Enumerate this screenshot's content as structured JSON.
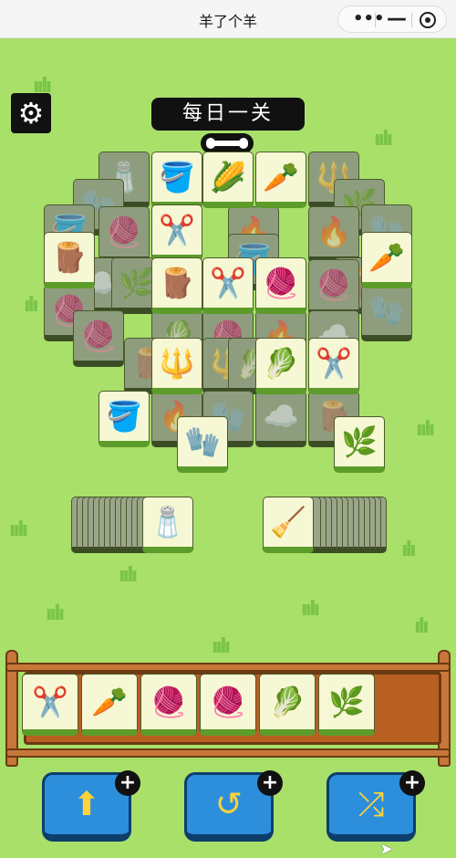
{
  "window": {
    "title": "羊了个羊"
  },
  "capsule": {
    "dots": "•••",
    "minus": "—"
  },
  "level": {
    "label": "每日一关"
  },
  "board": {
    "tiles_top": [
      {
        "icon": "🧂",
        "dim": true
      },
      {
        "icon": "🪣",
        "dim": false
      },
      {
        "icon": "🌽",
        "dim": false
      },
      {
        "icon": "🥕",
        "dim": false
      },
      {
        "icon": "🔱",
        "dim": true
      }
    ],
    "tiles_main": [
      {
        "icon": "✂️",
        "dim": false
      },
      {
        "icon": "🪵",
        "dim": false
      },
      {
        "icon": "✂️",
        "dim": false
      },
      {
        "icon": "🧶",
        "dim": false
      },
      {
        "icon": "🪵",
        "dim": false
      },
      {
        "icon": "🥕",
        "dim": false
      },
      {
        "icon": "🔱",
        "dim": false
      },
      {
        "icon": "🥬",
        "dim": false
      },
      {
        "icon": "✂️",
        "dim": false
      },
      {
        "icon": "🪣",
        "dim": false
      },
      {
        "icon": "🧤",
        "dim": false
      },
      {
        "icon": "🌿",
        "dim": false
      }
    ],
    "tiles_dim": [
      {
        "icon": "🧂"
      },
      {
        "icon": "🪣"
      },
      {
        "icon": "🌿"
      },
      {
        "icon": "🧤"
      },
      {
        "icon": "🧶"
      },
      {
        "icon": "🧶"
      },
      {
        "icon": "🥬"
      },
      {
        "icon": "🔥"
      },
      {
        "icon": "🪵"
      },
      {
        "icon": "🔥"
      },
      {
        "icon": "🧤"
      },
      {
        "icon": "☁️"
      }
    ]
  },
  "side_stacks": {
    "left_top": "🧂",
    "right_top": "🧹"
  },
  "slot": {
    "tiles": [
      "✂️",
      "🥕",
      "🧶",
      "🧶",
      "🥬",
      "🌿"
    ]
  },
  "tools": [
    {
      "icon": "⬆",
      "plus": "+"
    },
    {
      "icon": "↺",
      "plus": "+"
    },
    {
      "icon": "⤮",
      "plus": "+"
    }
  ],
  "gear_icon": "⚙"
}
